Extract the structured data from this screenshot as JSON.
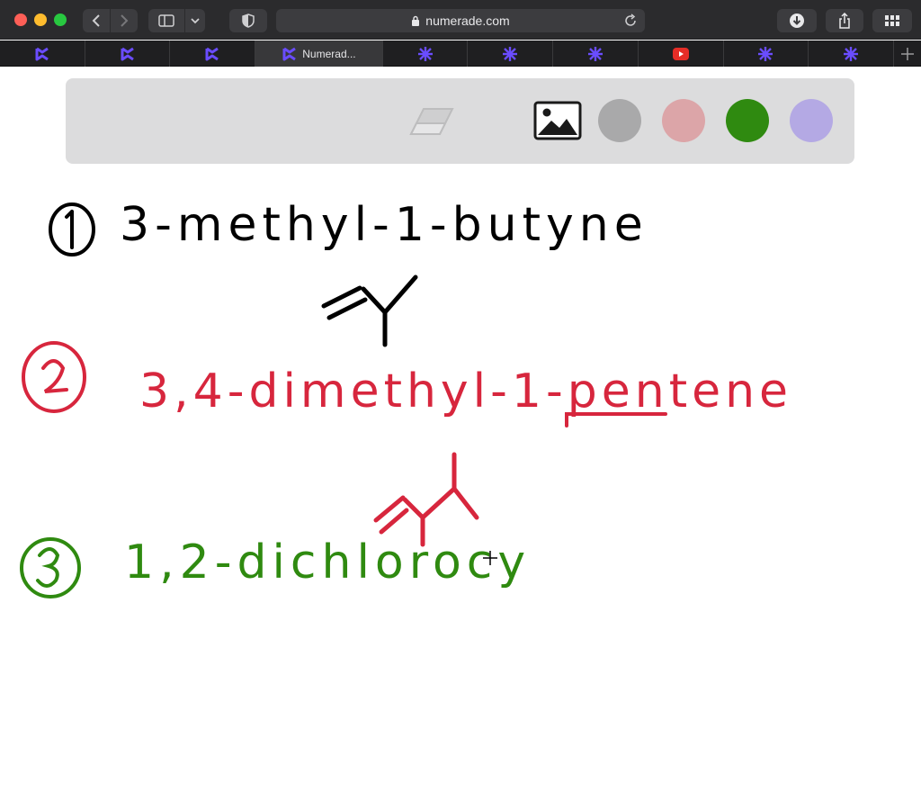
{
  "browser": {
    "url": "numerade.com",
    "tabs": [
      {
        "icon": "numerade-logo-icon",
        "label": ""
      },
      {
        "icon": "numerade-logo-icon",
        "label": ""
      },
      {
        "icon": "numerade-logo-icon",
        "label": ""
      },
      {
        "icon": "numerade-logo-icon",
        "label": "Numerad..."
      },
      {
        "icon": "asterisk-icon",
        "label": ""
      },
      {
        "icon": "asterisk-icon",
        "label": ""
      },
      {
        "icon": "asterisk-icon",
        "label": ""
      },
      {
        "icon": "youtube-icon",
        "label": ""
      },
      {
        "icon": "asterisk-icon",
        "label": ""
      },
      {
        "icon": "asterisk-icon",
        "label": ""
      }
    ]
  },
  "toolbar": {
    "tools": [
      "eraser-icon",
      "image-icon"
    ],
    "colors": [
      "#a9a9aa",
      "#dca5a8",
      "#2f8a10",
      "#b4a9e4"
    ]
  },
  "canvas": {
    "problems": [
      {
        "number": "1",
        "name": "3-methyl-1-butyne",
        "color": "#000000"
      },
      {
        "number": "2",
        "name": "3,4-dimethyl-1-pentene",
        "color": "#d7263d"
      },
      {
        "number": "3",
        "name": "1,2-dichlorocy",
        "color": "#2f8a10"
      }
    ]
  }
}
